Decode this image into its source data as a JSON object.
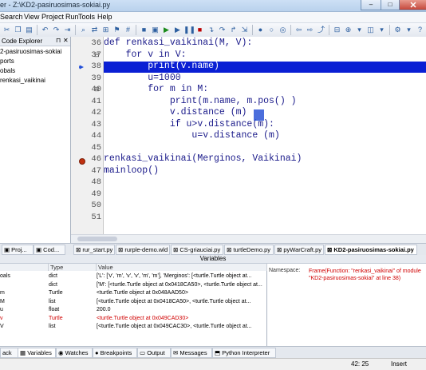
{
  "window": {
    "title": "er - Z:\\KD2-pasiruosimas-sokiai.py",
    "minimize": "–",
    "maximize": "□"
  },
  "menu": [
    "Search",
    "View",
    "Project",
    "Run",
    "Tools",
    "Help"
  ],
  "explorer": {
    "title": "Code Explorer",
    "items": [
      "2-pasiruosimas-sokiai",
      "ports",
      "obals",
      "renkasi_vaikinai"
    ]
  },
  "editor": {
    "lines": [
      {
        "n": "36",
        "code": "def renkasi_vaikinai(M, V):"
      },
      {
        "n": "37",
        "code": "    for v in V:"
      },
      {
        "n": "38",
        "code": "        print(v.name)"
      },
      {
        "n": "39",
        "code": "        u=1000"
      },
      {
        "n": "40",
        "code": "        for m in M:"
      },
      {
        "n": "41",
        "code": "            print(m.name, m.pos() )"
      },
      {
        "n": "42",
        "code": "            v.distance (m)"
      },
      {
        "n": "43",
        "code": "            if u>v.distance(m):"
      },
      {
        "n": "44",
        "code": "                u=v.distance (m)"
      },
      {
        "n": "45",
        "code": ""
      },
      {
        "n": "46",
        "code": "renkasi_vaikinai(Merginos, Vaikinai)"
      },
      {
        "n": "47",
        "code": "mainloop()"
      },
      {
        "n": "48",
        "code": ""
      },
      {
        "n": "49",
        "code": ""
      },
      {
        "n": "50",
        "code": ""
      },
      {
        "n": "51",
        "code": ""
      }
    ]
  },
  "left_tabs": [
    "Proj...",
    "Cod..."
  ],
  "file_tabs": [
    "rur_start.py",
    "rurple-demo.wld",
    "CS-griauciai.py",
    "turtleDemo.py",
    "pyWarCraft.py",
    "KD2-pasiruosimas-sokiai.py"
  ],
  "variables": {
    "title": "Variables",
    "columns": [
      "",
      "Type",
      "Value"
    ],
    "rows": [
      {
        "name": "oals",
        "type": "dict",
        "value": "['L': ['v', 'm', 'v', 'v', 'm', 'm'], 'Merginos': [<turtle.Turtle object at...",
        "changed": false
      },
      {
        "name": "",
        "type": "dict",
        "value": "['M': [<turtle.Turtle object at 0x0418CA50>, <turtle.Turtle object at...",
        "changed": false
      },
      {
        "name": "m",
        "type": "Turtle",
        "value": "<turtle.Turtle object at 0x048AAD50>",
        "changed": false
      },
      {
        "name": "M",
        "type": "list",
        "value": "[<turtle.Turtle object at 0x0418CA50>, <turtle.Turtle object at...",
        "changed": false
      },
      {
        "name": "u",
        "type": "float",
        "value": "200.0",
        "changed": false
      },
      {
        "name": "v",
        "type": "Turtle",
        "value": "<turtle.Turtle object at 0x049CAD30>",
        "changed": true
      },
      {
        "name": "V",
        "type": "list",
        "value": "[<turtle.Turtle object at 0x049CAC30>, <turtle.Turtle object at...",
        "changed": false
      }
    ]
  },
  "namespace": {
    "label": "Namespace:",
    "value": "Frame(Function: \"renkasi_vaikinai\" of module \"KD2-pasiruosimas-sokiai\" at line 38)"
  },
  "bottom_tabs": [
    "ack",
    "Variables",
    "Watches",
    "Breakpoints",
    "Output",
    "Messages",
    "Python Interpreter"
  ],
  "status": {
    "position": "42: 25",
    "mode": "Insert"
  },
  "colors": {
    "highlight": "#0a1fd4",
    "changed_value": "#d00000"
  }
}
